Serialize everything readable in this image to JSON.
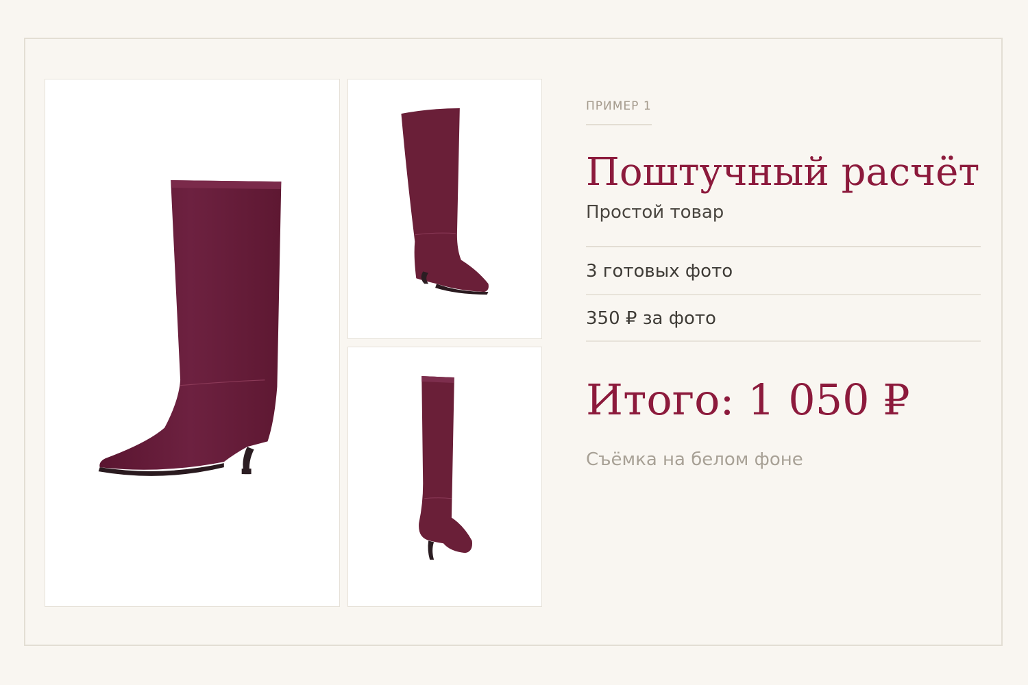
{
  "card": {
    "eyebrow": "ПРИМЕР 1",
    "title": "Поштучный расчёт",
    "subtitle": "Простой товар",
    "details": [
      "3 готовых фото",
      "350 ₽ за фото"
    ],
    "total": "Итого: 1 050 ₽",
    "note": "Съёмка на белом фоне"
  },
  "colors": {
    "accent": "#8c1a3c",
    "background": "#f9f6f1",
    "boot": "#6a1f38"
  }
}
